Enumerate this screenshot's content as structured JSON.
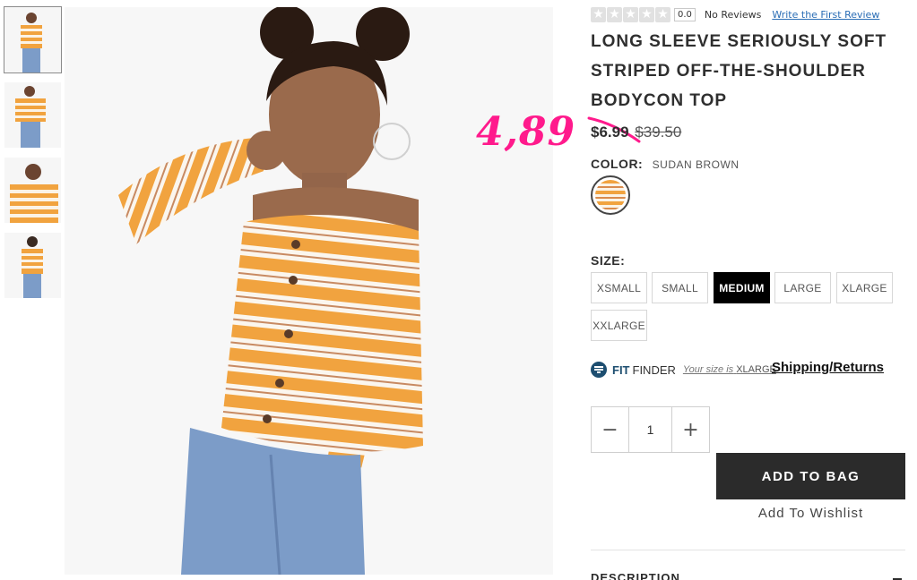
{
  "rating": {
    "score": "0.0",
    "reviews": "No Reviews",
    "write_review": "Write the First Review"
  },
  "product": {
    "title": "LONG SLEEVE SERIOUSLY SOFT STRIPED OFF-THE-SHOULDER BODYCON TOP",
    "price_sale": "$6.99",
    "price_original": "$39.50",
    "handwritten_price": "4,89"
  },
  "color": {
    "label": "COLOR:",
    "name": "SUDAN BROWN"
  },
  "size": {
    "label": "SIZE:",
    "options": [
      "XSMALL",
      "SMALL",
      "MEDIUM",
      "LARGE",
      "XLARGE",
      "XXLARGE"
    ],
    "selected": "MEDIUM"
  },
  "fit_finder": {
    "brand_strong": "FIT",
    "brand_light": "FINDER",
    "your_size_prefix": "Your size is",
    "your_size_value": "XLARGE"
  },
  "shipping_link": "Shipping/Returns",
  "quantity": {
    "minus": "−",
    "value": "1",
    "plus": "+"
  },
  "actions": {
    "add_to_bag": "ADD TO BAG",
    "wishlist": "Add To Wishlist"
  },
  "description": {
    "label": "DESCRIPTION"
  },
  "colors": {
    "accent_overlay": "#ff1a8c",
    "primary_button": "#2b2b2b",
    "selected_size": "#000000",
    "fit_finder": "#1d4e70",
    "stripe_orange": "#f1a33f"
  }
}
